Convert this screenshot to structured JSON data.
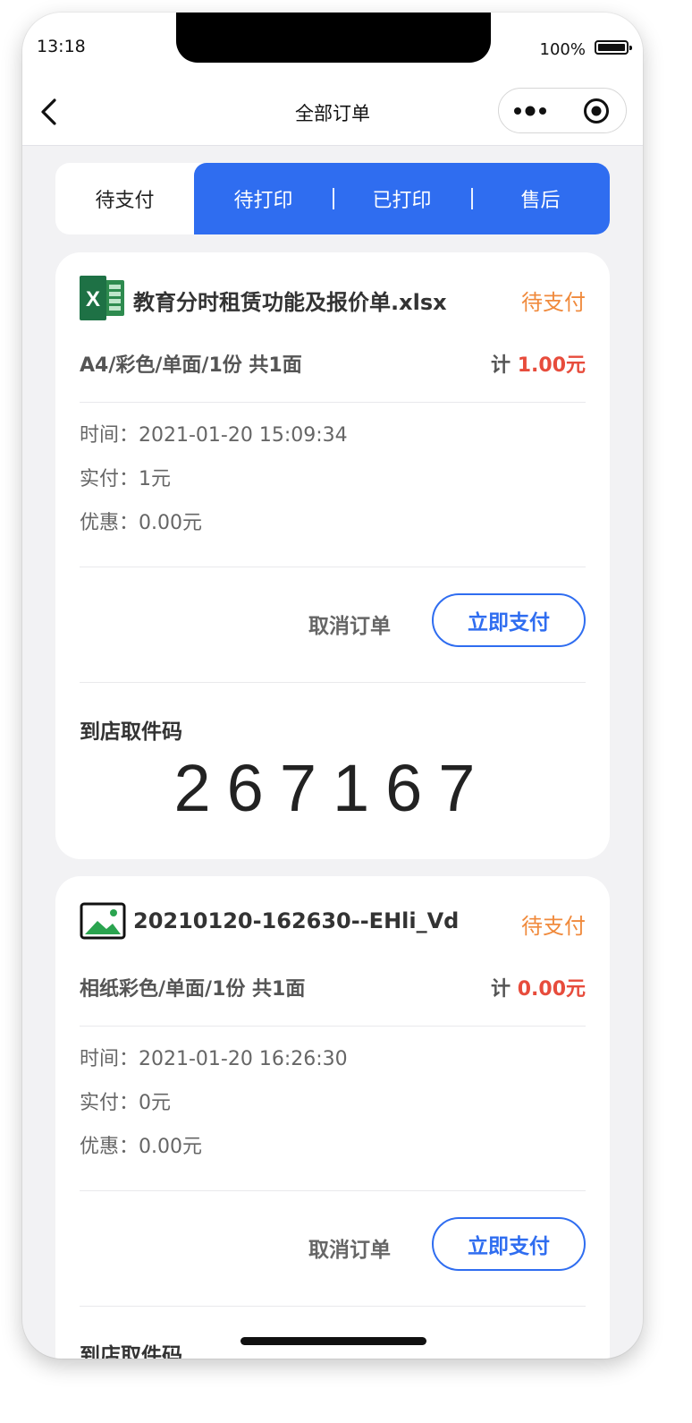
{
  "status_bar": {
    "time": "13:18",
    "battery": "100%"
  },
  "nav": {
    "title": "全部订单"
  },
  "tabs": [
    {
      "label": "待支付",
      "active": true
    },
    {
      "label": "待打印",
      "active": false
    },
    {
      "label": "已打印",
      "active": false
    },
    {
      "label": "售后",
      "active": false
    }
  ],
  "orders": [
    {
      "file_icon": "excel-file-icon",
      "file_name": "教育分时租赁功能及报价单.xlsx",
      "status": "待支付",
      "spec": "A4/彩色/单面/1份 共1面",
      "total_prefix": "计",
      "total_amount": "1.00元",
      "time": "时间：2021-01-20 15:09:34",
      "paid": "实付：1元",
      "discount": "优惠：0.00元",
      "cancel_label": "取消订单",
      "pay_label": "立即支付",
      "pickup_label": "到店取件码",
      "pickup_code": "267167"
    },
    {
      "file_icon": "image-file-icon",
      "file_name": "20210120-162630--EHli_Vd",
      "status": "待支付",
      "spec": "相纸彩色/单面/1份 共1面",
      "total_prefix": "计",
      "total_amount": "0.00元",
      "time": "时间：2021-01-20 16:26:30",
      "paid": "实付：0元",
      "discount": "优惠：0.00元",
      "cancel_label": "取消订单",
      "pay_label": "立即支付",
      "pickup_label": "到店取件码"
    }
  ],
  "colors": {
    "accent": "#2f6df0",
    "status_pending": "#f08a3c",
    "amount": "#e74c3c",
    "background": "#f2f2f4"
  }
}
